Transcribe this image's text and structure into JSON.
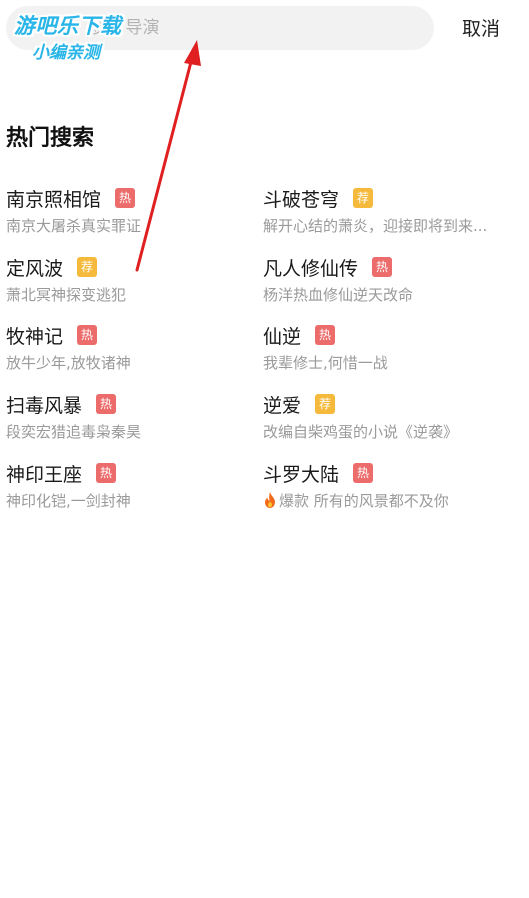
{
  "search": {
    "placeholder_visible": "员 / 导演"
  },
  "watermark": {
    "line1": "游吧乐下载",
    "line2": "小编亲测"
  },
  "header": {
    "cancel_label": "取消"
  },
  "hot_search": {
    "title": "热门搜索",
    "items": [
      {
        "title": "南京照相馆",
        "badge": "热",
        "badge_type": "hot",
        "desc": "南京大屠杀真实罪证"
      },
      {
        "title": "斗破苍穹",
        "badge": "荐",
        "badge_type": "recommend",
        "desc": "解开心结的萧炎，迎接即将到来..."
      },
      {
        "title": "定风波",
        "badge": "荐",
        "badge_type": "recommend",
        "desc": "萧北冥神探变逃犯"
      },
      {
        "title": "凡人修仙传",
        "badge": "热",
        "badge_type": "hot",
        "desc": "杨洋热血修仙逆天改命"
      },
      {
        "title": "牧神记",
        "badge": "热",
        "badge_type": "hot",
        "desc": "放牛少年,放牧诸神"
      },
      {
        "title": "仙逆",
        "badge": "热",
        "badge_type": "hot",
        "desc": "我辈修士,何惜一战"
      },
      {
        "title": "扫毒风暴",
        "badge": "热",
        "badge_type": "hot",
        "desc": "段奕宏猎追毒枭秦昊"
      },
      {
        "title": "逆爱",
        "badge": "荐",
        "badge_type": "recommend",
        "desc": "改编自柴鸡蛋的小说《逆袭》"
      },
      {
        "title": "神印王座",
        "badge": "热",
        "badge_type": "hot",
        "desc": "神印化铠,一剑封神"
      },
      {
        "title": "斗罗大陆",
        "badge": "热",
        "badge_type": "hot",
        "desc": "爆款 所有的风景都不及你",
        "desc_icon": "fire-icon"
      }
    ]
  },
  "colors": {
    "hot_badge": "#ec6b6b",
    "recommend_badge": "#f5b93c",
    "annotation_arrow": "#e02020",
    "watermark": "#29b5e8"
  }
}
